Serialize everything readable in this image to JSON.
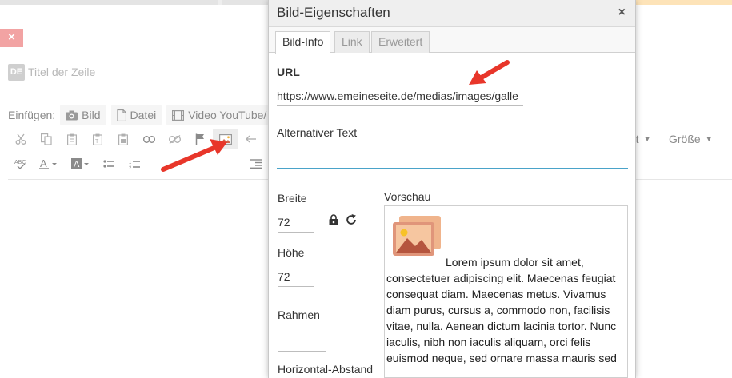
{
  "editor": {
    "title_placeholder": "Titel der Zeile",
    "lang_badge": "DE",
    "close_symbol": "×",
    "insert_label": "Einfügen:",
    "insert_buttons": [
      {
        "label": "Bild",
        "icon": "camera-icon"
      },
      {
        "label": "Datei",
        "icon": "file-icon"
      },
      {
        "label": "Video YouTube/",
        "icon": "film-icon"
      }
    ],
    "format_dropdown_partial": "rt",
    "size_dropdown": "Größe"
  },
  "dialog": {
    "title": "Bild-Eigenschaften",
    "close_symbol": "×",
    "tabs": [
      "Bild-Info",
      "Link",
      "Erweitert"
    ],
    "active_tab": "Bild-Info",
    "url_label": "URL",
    "url_value": "https://www.emeineseite.de/medias/images/galle",
    "alt_label": "Alternativer Text",
    "alt_value": "",
    "width_label": "Breite",
    "width_value": "72",
    "height_label": "Höhe",
    "height_value": "72",
    "border_label": "Rahmen",
    "border_value": "",
    "hspace_label": "Horizontal-Abstand",
    "preview_label": "Vorschau",
    "preview_text": "Lorem ipsum dolor sit amet, consectetuer adipiscing elit. Maecenas feugiat consequat diam. Maecenas metus. Vivamus diam purus, cursus a, commodo non, facilisis vitae, nulla. Aenean dictum lacinia tortor. Nunc iaculis, nibh non iaculis aliquam, orci felis euismod neque, sed ornare massa mauris sed"
  },
  "colors": {
    "accent_underline": "#4aa3c9",
    "arrow_red": "#e8362a",
    "close_badge": "#f2a3a3"
  }
}
